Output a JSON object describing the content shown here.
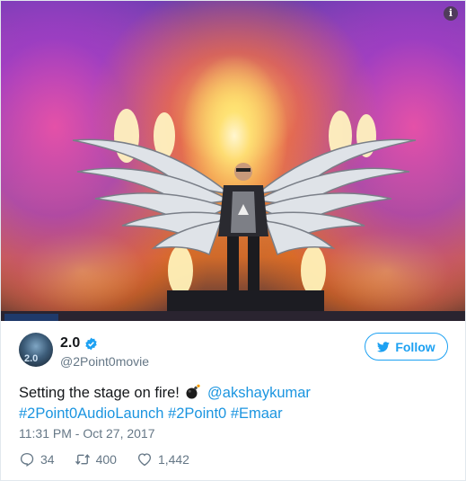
{
  "media": {
    "info_icon_glyph": "i"
  },
  "author": {
    "avatar_text": "2.0",
    "display_name": "2.0",
    "handle": "@2Point0movie",
    "verified": true
  },
  "follow_button": {
    "label": "Follow"
  },
  "tweet": {
    "text_lead": "Setting the stage on fire! ",
    "emoji": "bomb-icon",
    "mention": "@akshaykumar",
    "hashtags": [
      "#2Point0AudioLaunch",
      "#2Point0",
      "#Emaar"
    ],
    "timestamp": "11:31 PM - Oct 27, 2017"
  },
  "actions": {
    "replies": "34",
    "retweets": "400",
    "likes": "1,442"
  },
  "colors": {
    "link": "#1b95e0",
    "follow": "#1da1f2",
    "muted": "#657786",
    "text": "#14171a"
  }
}
